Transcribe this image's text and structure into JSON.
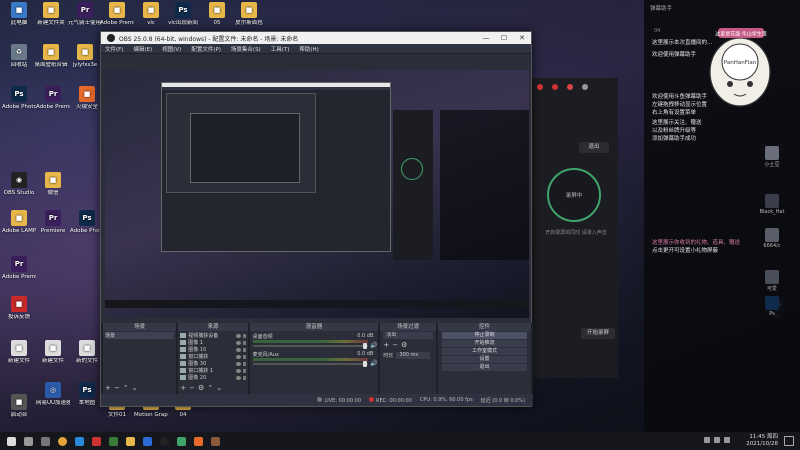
{
  "desktop": {
    "icons": [
      {
        "label": "此电脑",
        "glyph": "■",
        "color": "#3a78c8"
      },
      {
        "label": "新建文件夹",
        "glyph": "■",
        "color": "#e8b74a"
      },
      {
        "label": "元气骑士使用教程",
        "glyph": "Pr",
        "color": "#3a1f5c"
      },
      {
        "label": "Adobe Premier",
        "glyph": "■",
        "color": "#e8b74a"
      },
      {
        "label": "vlc",
        "glyph": "■",
        "color": "#e8b74a"
      },
      {
        "label": "vlc出现新闻",
        "glyph": "Ps",
        "color": "#0f2a4a"
      },
      {
        "label": "05",
        "glyph": "■",
        "color": "#e8b74a"
      },
      {
        "label": "皮尔斯面包",
        "glyph": "■",
        "color": "#e8b74a"
      },
      {
        "label": "回收站",
        "glyph": "♻",
        "color": "#6a7a8a"
      },
      {
        "label": "桌面壁纸合辑",
        "glyph": "■",
        "color": "#e8b74a"
      },
      {
        "label": "jylyfxs3e",
        "glyph": "■",
        "color": "#e8b74a"
      },
      {
        "label": "Adobe Photosh",
        "glyph": "Ps",
        "color": "#0f2a4a"
      },
      {
        "label": "Adobe Premiere",
        "glyph": "Pr",
        "color": "#3a1f5c"
      },
      {
        "label": "火绒安全",
        "glyph": "■",
        "color": "#e86a2a"
      },
      {
        "label": "OBS Studio",
        "glyph": "◉",
        "color": "#222"
      },
      {
        "label": "微信",
        "glyph": "■",
        "color": "#e8b74a"
      },
      {
        "label": "Adobe LAMP",
        "glyph": "■",
        "color": "#e8b74a"
      },
      {
        "label": "Premiere",
        "glyph": "Pr",
        "color": "#3a1f5c"
      },
      {
        "label": "Adobe Photoshop",
        "glyph": "Ps",
        "color": "#0f2a4a"
      },
      {
        "label": "Adobe Premiere",
        "glyph": "Pr",
        "color": "#3a1f5c"
      },
      {
        "label": "投诉反馈",
        "glyph": "■",
        "color": "#c82a2a"
      },
      {
        "label": "新建文件",
        "glyph": "■",
        "color": "#ddd"
      },
      {
        "label": "新建文件",
        "glyph": "■",
        "color": "#ddd"
      },
      {
        "label": "网易UU加速器",
        "glyph": "◎",
        "color": "#2a5aa8"
      },
      {
        "label": "新的文件",
        "glyph": "■",
        "color": "#ddd"
      },
      {
        "label": "本地图",
        "glyph": "Ps",
        "color": "#0f2a4a"
      },
      {
        "label": "Motion Graphic...",
        "glyph": "■",
        "color": "#e8b74a"
      },
      {
        "label": "04",
        "glyph": "■",
        "color": "#e8b74a"
      },
      {
        "label": "文件01",
        "glyph": "■",
        "color": "#e8b74a"
      },
      {
        "label": "启动台",
        "glyph": "■",
        "color": "#555"
      },
      {
        "label": "Ps",
        "glyph": "Ps",
        "color": "#0f2a4a"
      }
    ]
  },
  "obs": {
    "title": "OBS 25.0.8 (64-bit, windows) - 配置文件: 未命名 - 场景: 未命名",
    "menu": [
      "文件(F)",
      "编辑(E)",
      "视图(V)",
      "配置文件(P)",
      "场景集合(S)",
      "工具(T)",
      "帮助(H)"
    ],
    "window_buttons": {
      "minimize": "—",
      "maximize": "☐",
      "close": "✕"
    },
    "docks": {
      "scenes": {
        "header": "场景",
        "items": [
          "场景"
        ]
      },
      "sources": {
        "header": "来源",
        "items": [
          "视频捕获设备",
          "图像 1",
          "图像 10",
          "窗口捕获",
          "图像 30",
          "窗口捕获 1",
          "图像 20"
        ]
      },
      "mixer": {
        "header": "混音器",
        "channels": [
          {
            "name": "桌面音频",
            "db": "0.0 dB"
          },
          {
            "name": "麦克风/Aux",
            "db": "0.0 dB"
          }
        ]
      },
      "transitions": {
        "header": "场景过渡",
        "type": "淡出",
        "duration_label": "时长",
        "duration_value": "300 ms"
      },
      "controls": {
        "header": "控件",
        "buttons": [
          "停止录制",
          "开始推流",
          "工作室模式",
          "设置",
          "退出"
        ]
      }
    },
    "status": {
      "live": "LIVE: 00:00:00",
      "rec": "REC: 00:00:00",
      "cpu": "CPU: 0.9%, 60.00 fps",
      "dropped": "延迟 (0.0 帧 0.0%)"
    }
  },
  "app_panel": {
    "exit_label": "退出",
    "record_label": "录屏中",
    "text1": "开启录屏的同时\n请录入声音",
    "bottom_button": "开始录屏"
  },
  "chat": {
    "header": "弹幕助手",
    "count": "04",
    "lines": [
      {
        "text": "这里展示本次直播间的...",
        "highlight": false
      },
      {
        "text": "欢迎使用弹幕助手",
        "highlight": false
      },
      {
        "text": "欢迎使用斗鱼弹幕助手",
        "highlight": false
      },
      {
        "text": "左键拖拽移动显示位置",
        "highlight": false
      },
      {
        "text": "右上角有设置菜单",
        "highlight": false
      },
      {
        "text": "这里展示关注、赠送",
        "highlight": false
      },
      {
        "text": "以及粉丝牌升级等",
        "highlight": false
      },
      {
        "text": "添加弹幕助手成功",
        "highlight": false
      },
      {
        "text": "这里展示你收到的礼物、道具、赠送",
        "highlight": true
      },
      {
        "text": "点击更开可设置小礼物屏蔽",
        "highlight": false
      }
    ],
    "mascot_text": "PanHanFlan",
    "mascot_badge": "这里是花面·华山学生馆",
    "side_users": [
      "小土豆",
      "Black_Hat",
      "6664/c",
      "可爱",
      "Ps"
    ]
  },
  "taskbar": {
    "time": "11:45 周四",
    "date": "2021/10/28",
    "pinned": [
      "start",
      "search",
      "taskview",
      "chrome",
      "edge",
      "app1",
      "app2",
      "explorer",
      "qq",
      "obs",
      "wechat",
      "app3",
      "app4"
    ]
  }
}
